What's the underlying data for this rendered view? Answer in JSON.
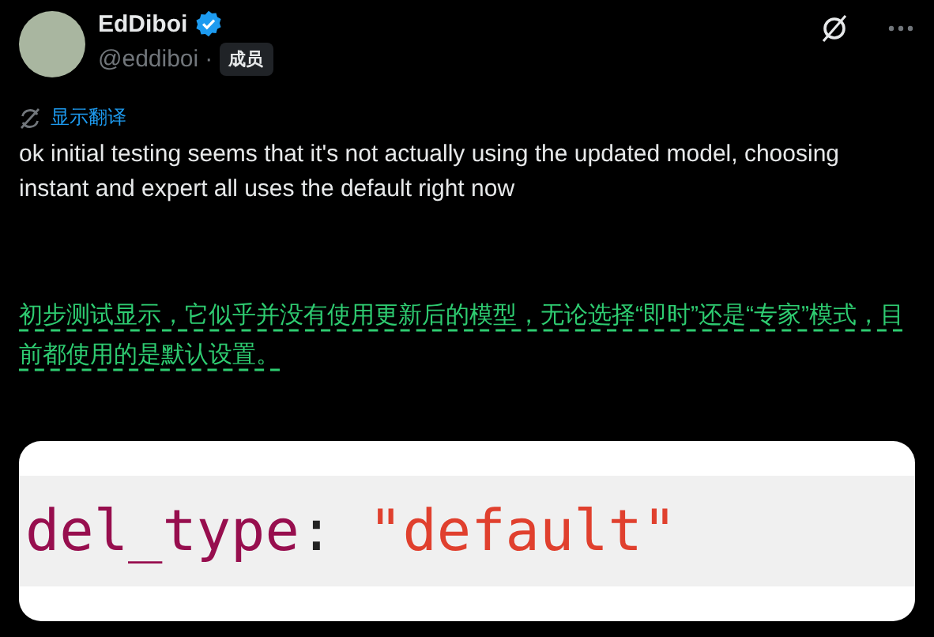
{
  "author": {
    "name": "EdDiboi",
    "verified": true,
    "handle": "@eddiboi",
    "separator": "·",
    "badge": "成员"
  },
  "translate_link": "显示翻译",
  "text": "ok initial testing seems that it's not actually using the updated model, choosing instant and expert all uses the default right now",
  "translation": "初步测试显示，它似乎并没有使用更新后的模型，无论选择“即时”还是“专家”模式，目前都使用的是默认设置。",
  "code_line": [
    {
      "kind": "key",
      "text": "del_type"
    },
    {
      "kind": "punct",
      "text": ":"
    },
    {
      "kind": "string",
      "text": "\"default\""
    }
  ]
}
